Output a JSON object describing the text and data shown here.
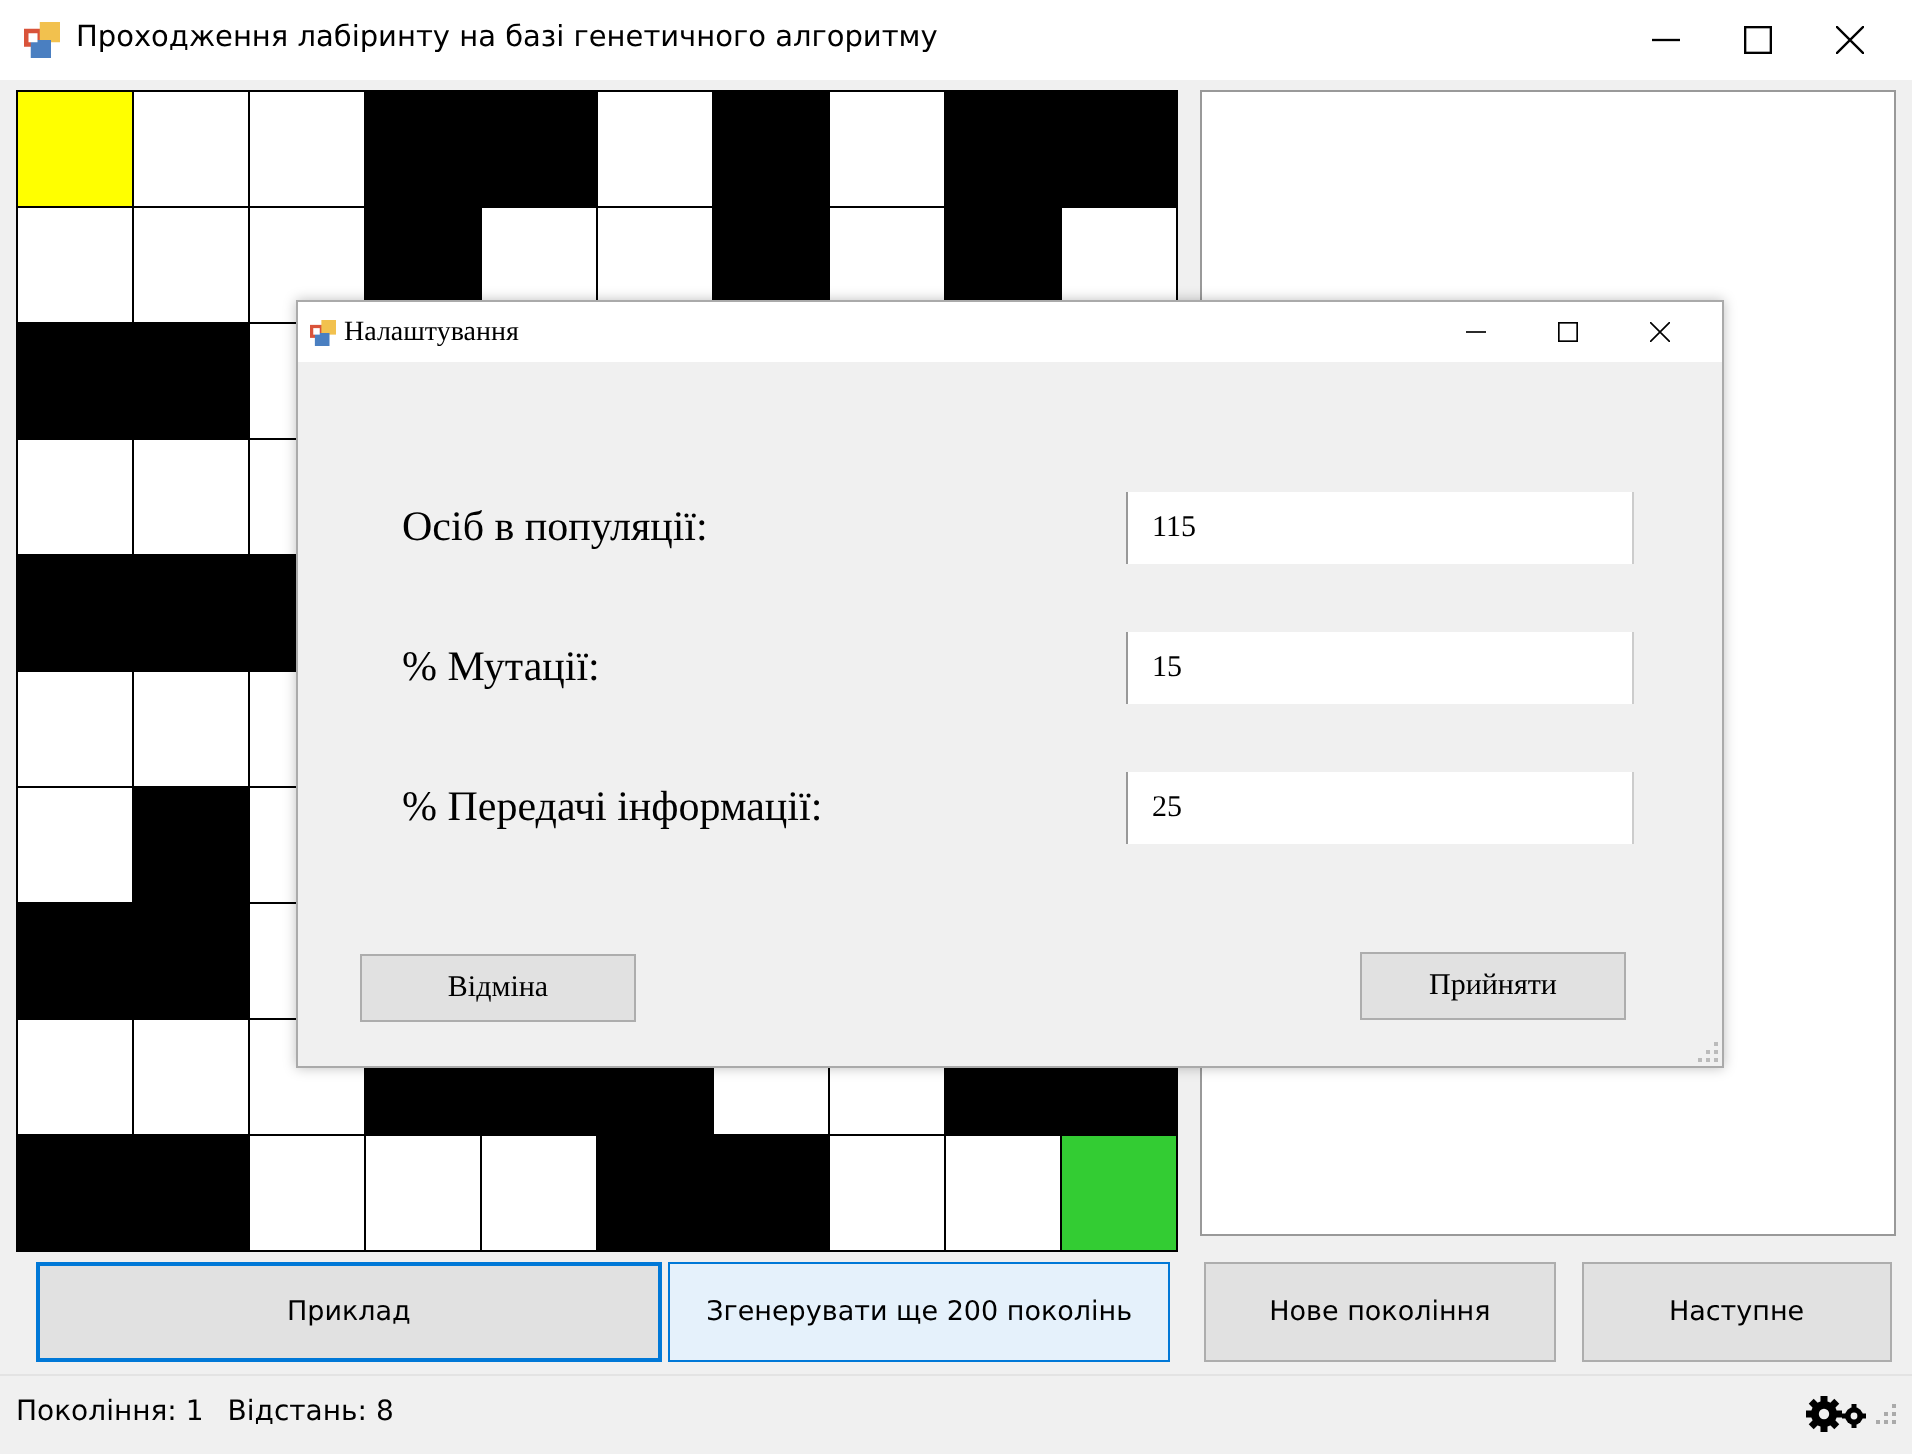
{
  "window": {
    "title": "Проходження лабіринту на базі генетичного алгоритму"
  },
  "maze": {
    "rows": [
      {
        "cells": [
          {
            "kind": "start"
          },
          {
            "kind": "open"
          },
          {
            "kind": "open"
          },
          {
            "kind": "wall"
          },
          {
            "kind": "wall"
          },
          {
            "kind": "open"
          },
          {
            "kind": "wall"
          },
          {
            "kind": "open"
          },
          {
            "kind": "wall"
          },
          {
            "kind": "wall"
          }
        ]
      },
      {
        "cells": [
          {
            "kind": "open"
          },
          {
            "kind": "open"
          },
          {
            "kind": "open"
          },
          {
            "kind": "wall"
          },
          {
            "kind": "open"
          },
          {
            "kind": "open"
          },
          {
            "kind": "wall"
          },
          {
            "kind": "open"
          },
          {
            "kind": "wall"
          },
          {
            "kind": "open"
          }
        ]
      },
      {
        "cells": [
          {
            "kind": "wall"
          },
          {
            "kind": "wall"
          },
          {
            "kind": "open"
          }
        ]
      },
      {
        "cells": [
          {
            "kind": "open"
          },
          {
            "kind": "open"
          },
          {
            "kind": "open"
          }
        ]
      },
      {
        "cells": [
          {
            "kind": "wall"
          },
          {
            "kind": "wall"
          },
          {
            "kind": "wall"
          }
        ]
      },
      {
        "cells": [
          {
            "kind": "open"
          },
          {
            "kind": "open"
          },
          {
            "kind": "open"
          }
        ]
      },
      {
        "cells": [
          {
            "kind": "open"
          },
          {
            "kind": "wall"
          },
          {
            "kind": "open"
          }
        ]
      },
      {
        "cells": [
          {
            "kind": "wall"
          },
          {
            "kind": "wall"
          },
          {
            "kind": "open"
          }
        ]
      },
      {
        "cells": [
          {
            "kind": "open"
          },
          {
            "kind": "open"
          },
          {
            "kind": "open"
          },
          {
            "kind": "wall"
          },
          {
            "kind": "wall"
          },
          {
            "kind": "wall"
          },
          {
            "kind": "open"
          },
          {
            "kind": "open"
          },
          {
            "kind": "wall"
          },
          {
            "kind": "wall"
          }
        ]
      },
      {
        "cells": [
          {
            "kind": "wall"
          },
          {
            "kind": "wall"
          },
          {
            "kind": "open"
          },
          {
            "kind": "open"
          },
          {
            "kind": "open"
          },
          {
            "kind": "wall"
          },
          {
            "kind": "wall"
          },
          {
            "kind": "open"
          },
          {
            "kind": "open"
          },
          {
            "kind": "finish"
          }
        ]
      }
    ]
  },
  "buttons": [
    {
      "label": "Приклад",
      "focused": true,
      "highlighted": false
    },
    {
      "label": "Згенерувати ще 200 поколінь",
      "focused": false,
      "highlighted": true
    },
    {
      "label": "Нове покоління",
      "focused": false,
      "highlighted": false
    },
    {
      "label": "Наступне",
      "focused": false,
      "highlighted": false
    }
  ],
  "status_bar": {
    "generation": "Покоління: 1",
    "distance": "Відстань: 8"
  },
  "dialog": {
    "title": "Налаштування",
    "fields": [
      {
        "label": "Осіб в популяції:",
        "value": "115"
      },
      {
        "label": "% Мутації:",
        "value": "15"
      },
      {
        "label": "% Передачі інформації:",
        "value": "25"
      }
    ],
    "buttons": [
      "Відміна",
      "Прийняти"
    ]
  }
}
